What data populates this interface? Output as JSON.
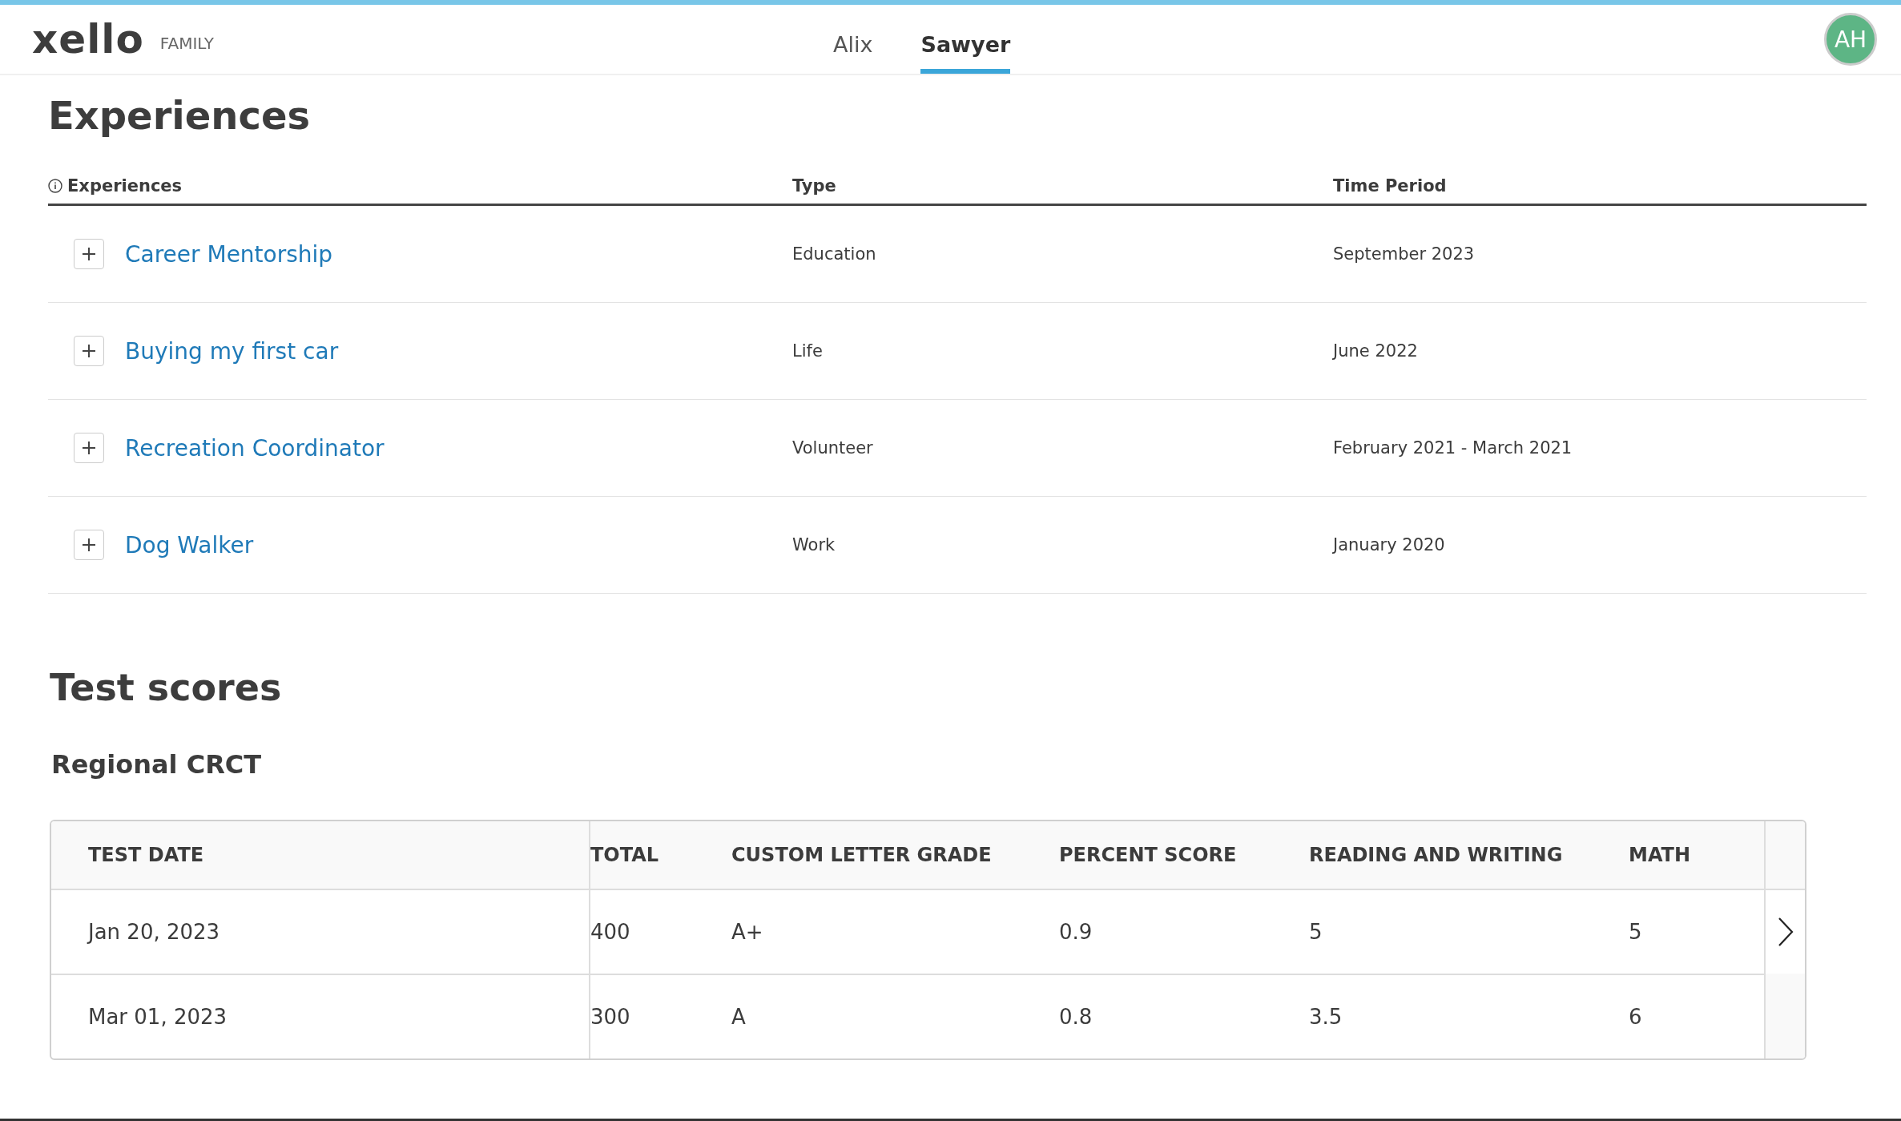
{
  "header": {
    "logo": "xello",
    "product": "FAMILY",
    "tabs": [
      {
        "label": "Alix",
        "selected": false
      },
      {
        "label": "Sawyer",
        "selected": true
      }
    ],
    "avatar": "AH"
  },
  "experiences": {
    "title": "Experiences",
    "columns": [
      "Experiences",
      "Type",
      "Time Period"
    ],
    "rows": [
      {
        "name": "Career Mentorship",
        "type": "Education",
        "period": "September 2023",
        "expanded": false
      },
      {
        "name": "Buying my first car",
        "type": "Life",
        "period": "June 2022",
        "expanded": false
      },
      {
        "name": "Recreation Coordinator",
        "type": "Volunteer",
        "period": "February 2021 - March 2021",
        "expanded": false
      },
      {
        "name": "Dog Walker",
        "type": "Work",
        "period": "January 2020",
        "expanded": false
      }
    ]
  },
  "test_scores": {
    "title": "Test scores",
    "test": "Regional CRCT",
    "columns": [
      "TEST DATE",
      "TOTAL",
      "CUSTOM LETTER GRADE",
      "PERCENT SCORE",
      "READING AND WRITING",
      "MATH"
    ],
    "rows": [
      [
        "Jan 20, 2023",
        "400",
        "A+",
        "0.9",
        "5",
        "5"
      ],
      [
        "Mar 01, 2023",
        "300",
        "A",
        "0.8",
        "3.5",
        "6"
      ]
    ]
  }
}
